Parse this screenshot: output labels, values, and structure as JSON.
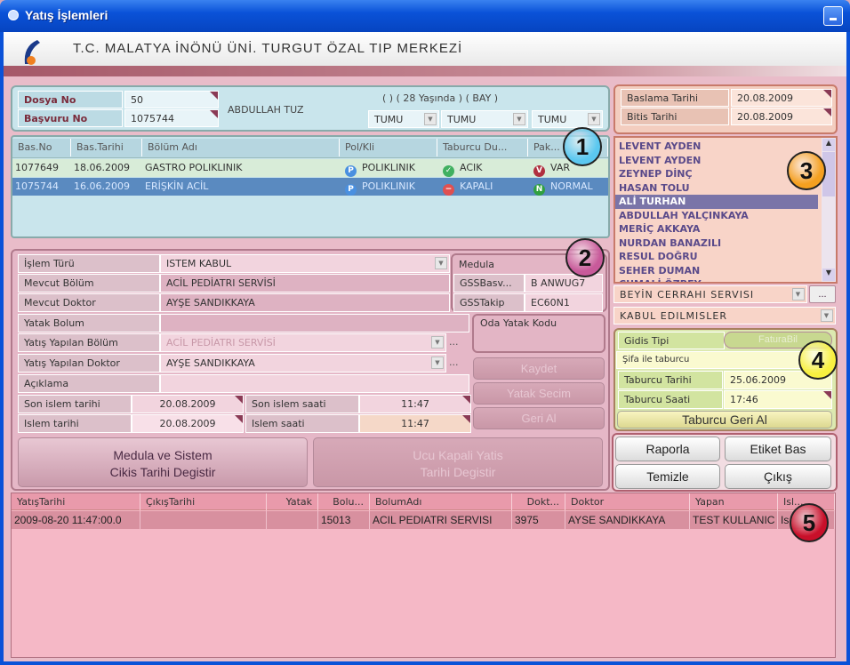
{
  "window": {
    "title": "Yatış İşlemleri"
  },
  "header": {
    "org": "T.C. MALATYA İNÖNÜ ÜNİ. TURGUT ÖZAL TIP MERKEZİ"
  },
  "patient": {
    "dosya_label": "Dosya No",
    "dosya_value": "50",
    "basvuru_label": "Başvuru No",
    "basvuru_value": "1075744",
    "name": "ABDULLAH TUZ",
    "info": "(  ) ( 28 Yaşında ) ( BAY )",
    "filters": [
      "TUMU",
      "TUMU",
      "TUMU"
    ]
  },
  "basvuru_grid": {
    "columns": [
      "Bas.No",
      "Bas.Tarihi",
      "Bölüm Adı",
      "Pol/Kli",
      "Taburcu Du...",
      "Pak..."
    ],
    "rows": [
      {
        "no": "1077649",
        "tarih": "18.06.2009",
        "bolum": "GASTRO POLIKLINIK",
        "pol": "POLIKLINIK",
        "taburcu": "ACIK",
        "pak": "VAR",
        "selected": false
      },
      {
        "no": "1075744",
        "tarih": "16.06.2009",
        "bolum": "ERİŞKİN ACİL",
        "pol": "POLIKLINIK",
        "taburcu": "KAPALI",
        "pak": "NORMAL",
        "selected": true
      }
    ]
  },
  "form": {
    "islem_turu_label": "İşlem Türü",
    "islem_turu": "ISTEM KABUL",
    "mevcut_bolum_label": "Mevcut Bölüm",
    "mevcut_bolum": "ACİL PEDİATRI SERVİSİ",
    "mevcut_doktor_label": "Mevcut Doktor",
    "mevcut_doktor": "AYŞE SANDIKKAYA",
    "yatak_bolum_label": "Yatak Bolum",
    "yatak_bolum": "",
    "yatis_bolum_label": "Yatış Yapılan Bölüm",
    "yatis_bolum": "ACİL PEDİATRI SERVİSİ",
    "yatis_doktor_label": "Yatış Yapılan Doktor",
    "yatis_doktor": "AYŞE SANDIKKAYA",
    "aciklama_label": "Açıklama",
    "aciklama": "",
    "son_islem_tarihi_label": "Son islem tarihi",
    "son_islem_tarihi": "20.08.2009",
    "son_islem_saati_label": "Son islem saati",
    "son_islem_saati": "11:47",
    "islem_tarihi_label": "Islem tarihi",
    "islem_tarihi": "20.08.2009",
    "islem_saati_label": "Islem saati",
    "islem_saati": "11:47",
    "dots": "...",
    "medula_label": "Medula",
    "gssbasv_label": "GSSBasv...",
    "gssbasv": "B ANWUG7",
    "gsstakip_label": "GSSTakip",
    "gsstakip": "EC60N1",
    "oda_yatak_label": "Oda Yatak Kodu",
    "oda_yatak": "",
    "kaydet": "Kaydet",
    "yatak_secim": "Yatak Secim",
    "geri_al": "Geri Al",
    "medula_btn_1": "Medula ve Sistem",
    "medula_btn_2": "Cikis Tarihi Degistir",
    "ucu_btn_1": "Ucu Kapali Yatis",
    "ucu_btn_2": "Tarihi Degistir"
  },
  "dates": {
    "baslama_label": "Baslama Tarihi",
    "baslama": "20.08.2009",
    "bitis_label": "Bitis Tarihi",
    "bitis": "20.08.2009"
  },
  "doctors": {
    "items": [
      "LEVENT AYDEN",
      "LEVENT AYDEN",
      "ZEYNEP DİNÇ",
      "HASAN TOLU",
      "ALİ TURHAN",
      "ABDULLAH YALÇINKAYA",
      "MERİÇ AKKAYA",
      "NURDAN BANAZILI",
      "RESUL DOĞRU",
      "SEHER DUMAN",
      "CUMALİ ÖZBEY"
    ],
    "selected": 4
  },
  "servis": {
    "value": "BEYİN CERRAHI SERVISI",
    "dots": "...",
    "filter": "KABUL EDILMISLER"
  },
  "taburcu": {
    "gidis_label": "Gidis Tipi",
    "fatura_btn": "FaturaBil",
    "gidis": "Şifa ile taburcu",
    "tarih_label": "Taburcu Tarihi",
    "tarih": "25.06.2009",
    "saat_label": "Taburcu Saati",
    "saat": "17:46",
    "geri_al": "Taburcu Geri Al"
  },
  "actions": {
    "raporla": "Raporla",
    "etiket": "Etiket Bas",
    "temizle": "Temizle",
    "cikis": "Çıkış"
  },
  "yatis_grid": {
    "columns": [
      "YatışTarihi",
      "ÇıkışTarihi",
      "Yatak",
      "Bolu...",
      "BolumAdı",
      "Dokt...",
      "Doktor",
      "Yapan",
      "Isl..."
    ],
    "rows": [
      [
        "2009-08-20 11:47:00.0",
        "",
        "",
        "15013",
        "ACIL PEDIATRI SERVISI",
        "3975",
        "AYSE SANDIKKAYA",
        "TEST KULLANIC",
        "Is"
      ]
    ]
  },
  "badges": [
    "1",
    "2",
    "3",
    "4",
    "5"
  ],
  "colors": {
    "badge1": "#5bc8f0",
    "badge2": "#c85a9a",
    "badge3": "#f5a020",
    "badge4": "#f8f040",
    "badge5": "#c8102a",
    "titlebar": "#0a52d8"
  }
}
